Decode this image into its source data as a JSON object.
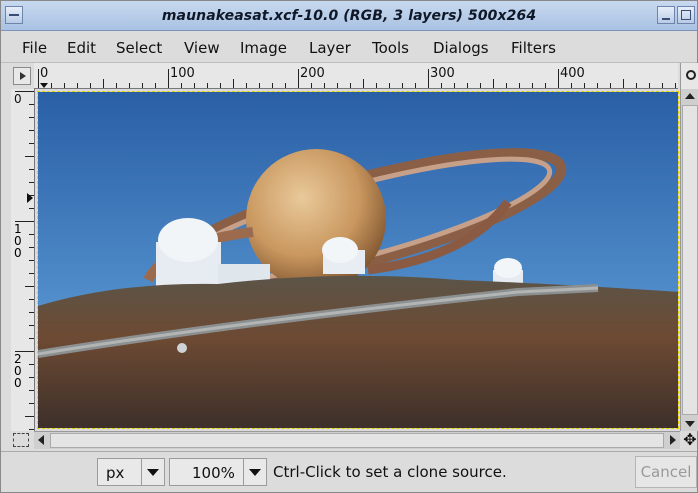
{
  "window": {
    "title": "maunakeasat.xcf-10.0 (RGB, 3 layers) 500x264"
  },
  "menu": {
    "items": [
      "File",
      "Edit",
      "Select",
      "View",
      "Image",
      "Layer",
      "Tools",
      "Dialogs",
      "Filters"
    ]
  },
  "rulers": {
    "horizontal_labels": [
      "0",
      "100",
      "200",
      "300",
      "400"
    ],
    "vertical_labels": [
      "0",
      "100",
      "200"
    ]
  },
  "status": {
    "unit": "px",
    "zoom": "100%",
    "message": "Ctrl-Click to set a clone source.",
    "cancel_label": "Cancel"
  },
  "icons": {
    "window_menu": "window-menu-icon",
    "minimize": "minimize-icon",
    "maximize": "maximize-icon",
    "ruler_menu": "ruler-menu-triangle-icon",
    "zoom": "zoom-icon",
    "quick_mask": "quick-mask-icon",
    "navigate": "navigate-move-icon"
  },
  "colors": {
    "titlebar": "#b8cde9",
    "canvas_border": "#e6d200",
    "sky": "#2f6fb4"
  }
}
